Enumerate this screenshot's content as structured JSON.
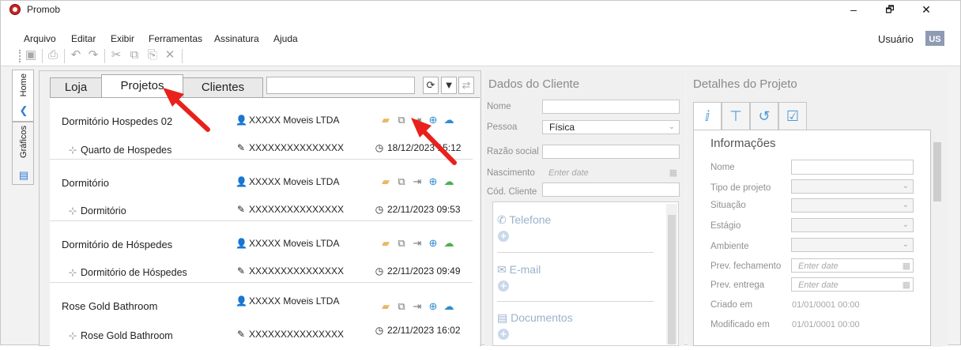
{
  "window": {
    "title": "Promob",
    "minimize": "–",
    "maximize": "🗗",
    "close": "✕"
  },
  "menu": [
    "Arquivo",
    "Editar",
    "Exibir",
    "Ferramentas",
    "Assinatura",
    "Ajuda"
  ],
  "user": {
    "label": "Usuário",
    "initials": "US"
  },
  "toolbar_icons": [
    "save-icon",
    "print-icon",
    "undo-icon",
    "redo-icon",
    "cut-icon",
    "copy-icon",
    "paste-icon",
    "delete-icon"
  ],
  "side_tabs": [
    {
      "label": "Home",
      "icon": "home-icon"
    },
    {
      "label": "Gráficos",
      "icon": "chart-icon"
    }
  ],
  "tabs": [
    "Loja",
    "Projetos",
    "Clientes"
  ],
  "active_tab": "Projetos",
  "search": {
    "value": ""
  },
  "projects": [
    {
      "name": "Dormitório Hospedes 02",
      "client": "XXXXX Moveis LTDA",
      "ambiente": "Quarto de Hospedes",
      "seller": "XXXXXXXXXXXXXXX",
      "date": "18/12/2023 15:12"
    },
    {
      "name": "Dormitório",
      "client": "XXXXX Moveis LTDA",
      "ambiente": "Dormitório",
      "seller": "XXXXXXXXXXXXXXX",
      "date": "22/11/2023 09:53"
    },
    {
      "name": "Dormitório de Hóspedes",
      "client": "XXXXX Moveis LTDA",
      "ambiente": "Dormitório de Hóspedes",
      "seller": "XXXXXXXXXXXXXXX",
      "date": "22/11/2023 09:49"
    },
    {
      "name": "Rose Gold Bathroom",
      "client": "XXXXX Moveis LTDA",
      "ambiente": "Rose Gold Bathroom",
      "seller": "XXXXXXXXXXXXXXX",
      "date": "22/11/2023 16:02"
    }
  ],
  "dados": {
    "title": "Dados do Cliente",
    "nome_label": "Nome",
    "pessoa_label": "Pessoa",
    "pessoa_value": "Física",
    "razao_label": "Razão social",
    "nascimento_label": "Nascimento",
    "nascimento_placeholder": "Enter date",
    "cod_label": "Cód. Cliente",
    "telefone": "Telefone",
    "email": "E-mail",
    "documentos": "Documentos"
  },
  "detalhes": {
    "title": "Detalhes do Projeto",
    "section": "Informações",
    "nome_label": "Nome",
    "tipo_label": "Tipo de projeto",
    "situacao_label": "Situação",
    "estagio_label": "Estágio",
    "ambiente_label": "Ambiente",
    "prev_fech_label": "Prev. fechamento",
    "prev_entrega_label": "Prev. entrega",
    "date_placeholder": "Enter date",
    "criado_label": "Criado em",
    "criado_value": "01/01/0001 00:00",
    "modificado_label": "Modificado em",
    "modificado_value": "01/01/0001 00:00"
  },
  "colors": {
    "accent": "#2b7bd6",
    "annotation": "#e8211c",
    "folder": "#e7b865",
    "cloud": "#2e8ccf"
  }
}
